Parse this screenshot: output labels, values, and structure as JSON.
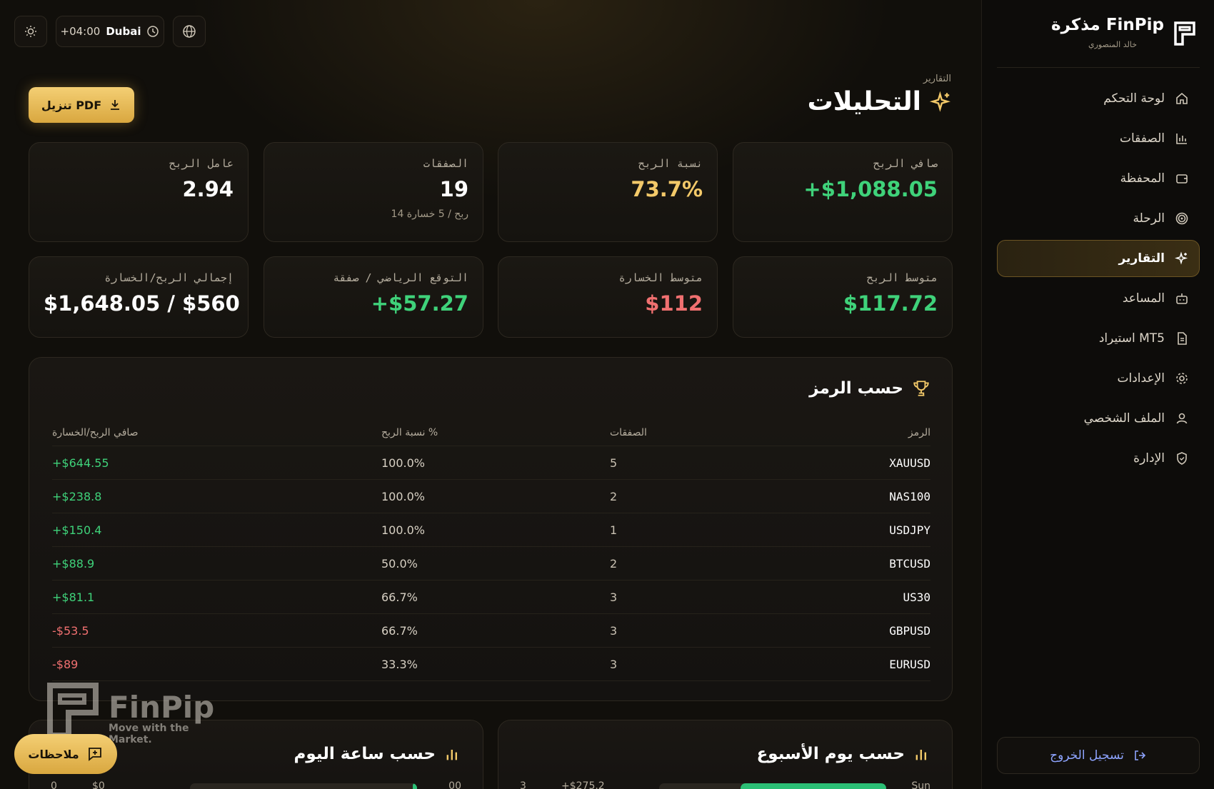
{
  "brand": {
    "title": "مذكرة FinPip",
    "subtitle": "خالد المنصوري"
  },
  "nav": {
    "items": [
      {
        "label": "لوحة التحكم",
        "icon": "home-icon"
      },
      {
        "label": "الصفقات",
        "icon": "bar-chart-icon"
      },
      {
        "label": "المحفظة",
        "icon": "wallet-icon"
      },
      {
        "label": "الرحلة",
        "icon": "target-icon"
      },
      {
        "label": "التقارير",
        "icon": "sparkles-icon",
        "active": true
      },
      {
        "label": "المساعد",
        "icon": "bot-icon"
      },
      {
        "label": "استيراد MT5",
        "icon": "file-icon"
      },
      {
        "label": "الإعدادات",
        "icon": "gear-icon"
      },
      {
        "label": "الملف الشخصي",
        "icon": "user-icon"
      },
      {
        "label": "الإدارة",
        "icon": "shield-icon"
      }
    ],
    "logout": "تسجيل الخروج"
  },
  "topbar": {
    "city": "Dubai",
    "offset": "+04:00"
  },
  "header": {
    "breadcrumb": "التقارير",
    "title": "التحليلات",
    "pdf_label": "تنزيل PDF"
  },
  "stats": {
    "net_profit": {
      "label": "صافي الربح",
      "value": "+$1,088.05"
    },
    "win_rate": {
      "label": "نسبة الربح",
      "value": "73.7%"
    },
    "trades": {
      "label": "الصفقات",
      "value": "19",
      "sub": "14 ربح / 5 خسارة"
    },
    "profit_factor": {
      "label": "عامل الربح",
      "value": "2.94"
    },
    "avg_win": {
      "label": "متوسط الربح",
      "value": "$117.72"
    },
    "avg_loss": {
      "label": "متوسط الخسارة",
      "value": "$112"
    },
    "expectancy": {
      "label": "التوقع الرياضي / صفقة",
      "value": "+$57.27"
    },
    "gross": {
      "label": "إجمالي الربح/الخسارة",
      "value": "$1,648.05 / $560"
    }
  },
  "by_symbol": {
    "title": "حسب الرمز",
    "headers": {
      "symbol": "الرمز",
      "trades": "الصفقات",
      "win_rate": "نسبة الربح %",
      "net": "صافي الربح/الخسارة"
    },
    "rows": [
      {
        "symbol": "XAUUSD",
        "trades": "5",
        "win_rate": "100.0%",
        "net": "+$644.55",
        "positive": true
      },
      {
        "symbol": "NAS100",
        "trades": "2",
        "win_rate": "100.0%",
        "net": "+$238.8",
        "positive": true
      },
      {
        "symbol": "USDJPY",
        "trades": "1",
        "win_rate": "100.0%",
        "net": "+$150.4",
        "positive": true
      },
      {
        "symbol": "BTCUSD",
        "trades": "2",
        "win_rate": "50.0%",
        "net": "+$88.9",
        "positive": true
      },
      {
        "symbol": "US30",
        "trades": "3",
        "win_rate": "66.7%",
        "net": "+$81.1",
        "positive": true
      },
      {
        "symbol": "GBPUSD",
        "trades": "3",
        "win_rate": "66.7%",
        "net": "-$53.5",
        "positive": false
      },
      {
        "symbol": "EURUSD",
        "trades": "3",
        "win_rate": "33.3%",
        "net": "-$89",
        "positive": false
      }
    ]
  },
  "by_weekday": {
    "title": "حسب يوم الأسبوع",
    "first_row": {
      "day": "Sun",
      "value": "+$275.2",
      "count": "3",
      "fill_fraction": 0.64
    }
  },
  "by_hour": {
    "title": "حسب ساعة اليوم",
    "first_row": {
      "hour": "00",
      "value": "$0",
      "count": "0",
      "fill_fraction": 0.02
    }
  },
  "watermark": {
    "name": "FinPip",
    "tagline": "Move with the Market."
  },
  "notes": {
    "label": "ملاحظات"
  }
}
